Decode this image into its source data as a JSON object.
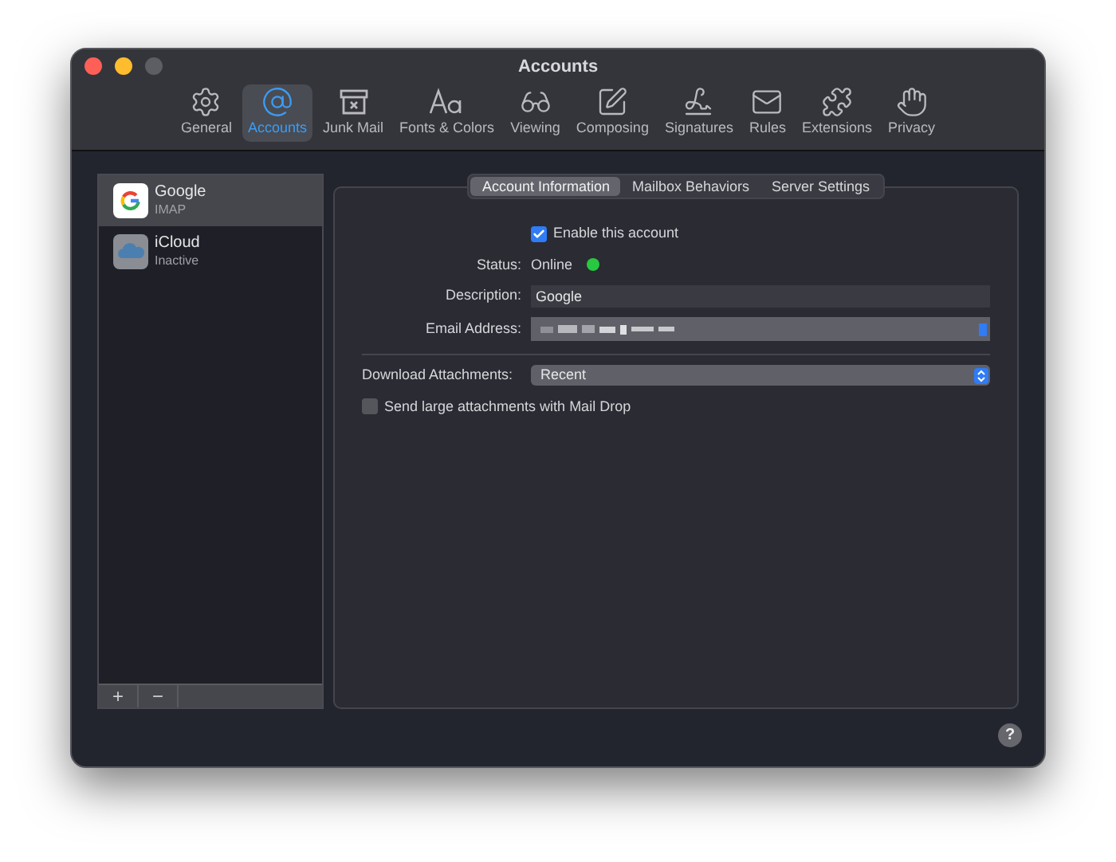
{
  "window": {
    "title": "Accounts"
  },
  "toolbar": [
    {
      "kind": "general",
      "label": "General",
      "selected": false
    },
    {
      "kind": "accounts",
      "label": "Accounts",
      "selected": true
    },
    {
      "kind": "junk",
      "label": "Junk Mail",
      "selected": false
    },
    {
      "kind": "fonts",
      "label": "Fonts & Colors",
      "selected": false
    },
    {
      "kind": "viewing",
      "label": "Viewing",
      "selected": false
    },
    {
      "kind": "composing",
      "label": "Composing",
      "selected": false
    },
    {
      "kind": "signatures",
      "label": "Signatures",
      "selected": false
    },
    {
      "kind": "rules",
      "label": "Rules",
      "selected": false
    },
    {
      "kind": "extensions",
      "label": "Extensions",
      "selected": false
    },
    {
      "kind": "privacy",
      "label": "Privacy",
      "selected": false
    }
  ],
  "accounts": [
    {
      "kind": "google",
      "name": "Google",
      "detail": "IMAP",
      "selected": true
    },
    {
      "kind": "icloud",
      "name": "iCloud",
      "detail": "Inactive",
      "selected": false
    }
  ],
  "account_buttons": [
    "+",
    "−"
  ],
  "tabs": [
    {
      "label": "Account Information",
      "selected": true
    },
    {
      "label": "Mailbox Behaviors",
      "selected": false
    },
    {
      "label": "Server Settings",
      "selected": false
    }
  ],
  "enable": {
    "label": "Enable this account",
    "checked": true
  },
  "status": {
    "label": "Status:",
    "value": "Online",
    "color": "#28c840"
  },
  "description": {
    "label": "Description:",
    "value": "Google"
  },
  "email": {
    "label": "Email Address:"
  },
  "download": {
    "label": "Download Attachments:",
    "value": "Recent"
  },
  "mail_drop": {
    "label": "Send large attachments with Mail Drop",
    "checked": false
  },
  "help": "?"
}
